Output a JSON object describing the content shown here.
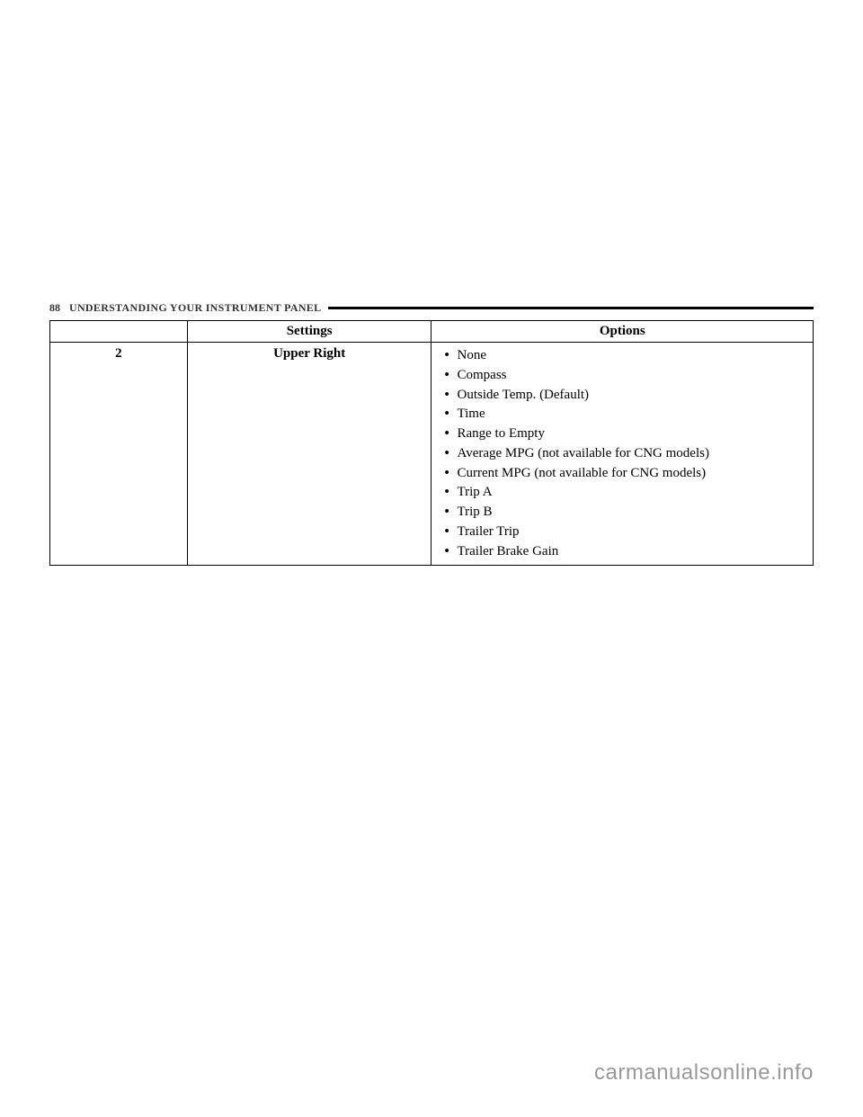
{
  "header": {
    "page_number": "88",
    "section_title": "UNDERSTANDING YOUR INSTRUMENT PANEL"
  },
  "table": {
    "headers": {
      "col1": "",
      "col2": "Settings",
      "col3": "Options"
    },
    "row": {
      "number": "2",
      "setting": "Upper Right",
      "options": [
        "None",
        "Compass",
        "Outside Temp. (Default)",
        "Time",
        "Range to Empty",
        "Average MPG (not available for CNG models)",
        "Current MPG (not available for CNG models)",
        "Trip A",
        "Trip B",
        "Trailer Trip",
        "Trailer Brake Gain"
      ]
    }
  },
  "watermark": "carmanualsonline.info"
}
